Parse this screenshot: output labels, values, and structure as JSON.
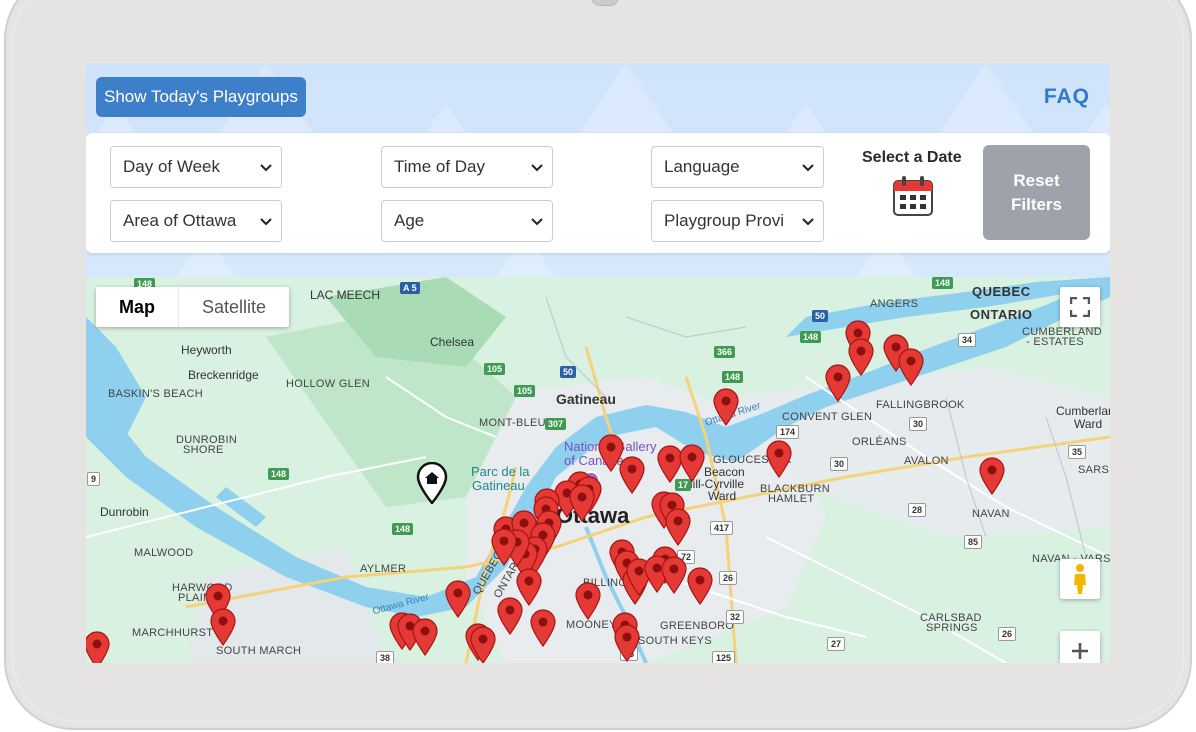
{
  "header": {
    "today_button": "Show Today's Playgroups",
    "faq_link": "FAQ"
  },
  "filters": {
    "day_of_week": "Day of Week",
    "time_of_day": "Time of Day",
    "language": "Language",
    "area": "Area of Ottawa",
    "age": "Age",
    "provider": "Playgroup Provi",
    "select_date_label": "Select a Date",
    "reset_line1": "Reset",
    "reset_line2": "Filters"
  },
  "map": {
    "type_map": "Map",
    "type_satellite": "Satellite",
    "labels": {
      "ottawa": "Ottawa",
      "gatineau": "Gatineau",
      "national_gallery_1": "National Gallery",
      "national_gallery_2": "of Canada",
      "parc_1": "Parc de la",
      "parc_2": "Gatineau",
      "beacon_1": "Beacon",
      "beacon_2": "Hill-Cyrville",
      "beacon_3": "Ward",
      "chelsea": "Chelsea",
      "heyworth": "Heyworth",
      "breckenridge": "Breckenridge",
      "hollow_glen": "HOLLOW GLEN",
      "baskins_beach": "BASKIN'S BEACH",
      "dunrobin_shore_1": "DUNROBIN",
      "dunrobin_shore_2": "SHORE",
      "dunrobin": "Dunrobin",
      "malwood": "MALWOOD",
      "harwood_plains_1": "HARWOOD",
      "harwood_plains_2": "PLAIN",
      "marchhurst": "MARCHHURST",
      "south_march": "SOUTH MARCH",
      "lac_meech": "LAC MEECH",
      "mont_bleu": "MONT-BLEU",
      "aylmer": "AYLMER",
      "quebec_map": "QUEBEC",
      "ontario_map": "ONTARIO",
      "billings": "BILLING",
      "mooneys": "MOONEY'S",
      "south_keys": "SOUTH KEYS",
      "greenboro": "GREENBORO",
      "gloucester": "GLOUCESTER",
      "blackburn_1": "BLACKBURN",
      "blackburn_2": "HAMLET",
      "convent_glen": "CONVENT GLEN",
      "orleans": "ORLÉANS",
      "avalon": "AVALON",
      "fallingbrook": "FALLINGBROOK",
      "angers": "ANGERS",
      "quebec_prov": "QUEBEC",
      "ontario_prov": "ONTARIO",
      "cumberland_estates_1": "CUMBERLAND",
      "cumberland_estates_2": "- ESTATES",
      "cumberland_ward_1": "Cumberlan",
      "cumberland_ward_2": "Ward",
      "navan": "NAVAN",
      "navan_vars": "NAVAN - VARS",
      "sarsf": "SARSF",
      "carlsbad_1": "CARLSBAD",
      "carlsbad_2": "SPRINGS",
      "ottawa_river_1": "Ottawa River",
      "ottawa_river_2": "Ottawa River"
    },
    "shields": [
      "148",
      "A 5",
      "105",
      "105",
      "50",
      "366",
      "148",
      "307",
      "148",
      "148",
      "148",
      "50",
      "148",
      "174",
      "30",
      "30",
      "34",
      "35",
      "28",
      "85",
      "17",
      "417",
      "72",
      "26",
      "32",
      "25",
      "38",
      "125",
      "27",
      "26",
      "9"
    ]
  }
}
